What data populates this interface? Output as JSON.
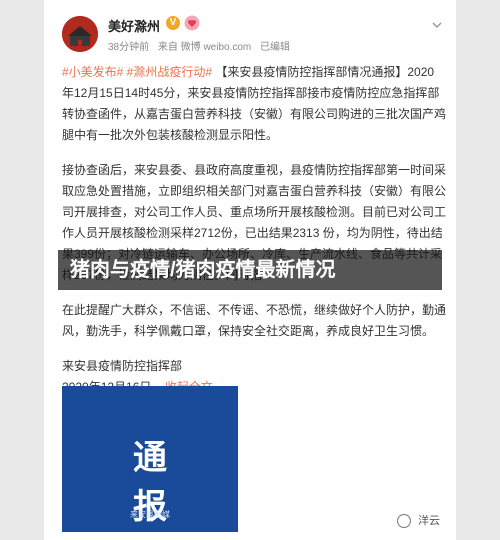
{
  "account": {
    "name": "美好滁州",
    "verified_badge": "V",
    "time": "38分钟前",
    "source": "来自 微博 weibo.com",
    "edited": "已编辑"
  },
  "post": {
    "hashtags": "#小美发布# #滁州战疫行动#",
    "para1": "【来安县疫情防控指挥部情况通报】2020年12月15日14时45分，来安县疫情防控指挥部接市疫情防控应急指挥部转协查函件，从嘉吉蛋白营养科技（安徽）有限公司购进的三批次国产鸡腿中有一批次外包装核酸检测显示阳性。",
    "para2": "接协查函后，来安县委、县政府高度重视，县疫情防控指挥部第一时间采取应急处置措施，立即组织相关部门对嘉吉蛋白营养科技（安徽）有限公司开展排查，对公司工作人员、重点场所开展核酸检测。目前已对公司工作人员开展核酸检测采样2712份，已出结果2313 份，均为阴性，待出结果399份；对冷链运输车、办公场所、冷库、生产流水线、食品等共计采样267份，检测结果均为阴性。同时指",
    "para3": "在此提醒广大群众，不信谣、不传谣、不恐慌，继续做好个人防护，勤通风，勤洗手，科学佩戴口罩，保持安全社交距离，养成良好卫生习惯。",
    "author": "来安县疫情防控指挥部",
    "date": "2020年12月16日",
    "collect": "收起全文"
  },
  "image": {
    "headline": "通报",
    "source_caption": "来安县融媒"
  },
  "watermark": "洋云",
  "overlay": {
    "title": "猪肉与疫情/猪肉疫情最新情况"
  },
  "colors": {
    "accent": "#eb7350",
    "notice_blue": "#1a4a9a",
    "overlay_bg": "#141414"
  }
}
